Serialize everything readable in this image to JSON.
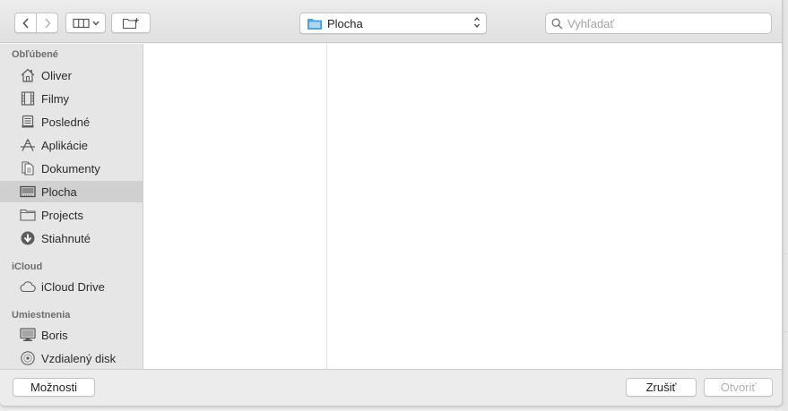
{
  "toolbar": {
    "back_icon": "chevron-left-icon",
    "forward_icon": "chevron-right-icon",
    "view_icon": "column-view-icon",
    "new_folder_icon": "new-folder-icon",
    "location": {
      "label": "Plocha",
      "icon": "desktop-folder-icon"
    },
    "search": {
      "placeholder": "Vyhľadať",
      "value": ""
    }
  },
  "sidebar": {
    "sections": [
      {
        "title": "Obľúbené",
        "items": [
          {
            "label": "Oliver",
            "icon": "home-icon"
          },
          {
            "label": "Filmy",
            "icon": "film-icon"
          },
          {
            "label": "Posledné",
            "icon": "recents-icon"
          },
          {
            "label": "Aplikácie",
            "icon": "applications-icon"
          },
          {
            "label": "Dokumenty",
            "icon": "documents-icon"
          },
          {
            "label": "Plocha",
            "icon": "desktop-icon",
            "selected": true
          },
          {
            "label": "Projects",
            "icon": "folder-icon"
          },
          {
            "label": "Stiahnuté",
            "icon": "download-icon"
          }
        ]
      },
      {
        "title": "iCloud",
        "items": [
          {
            "label": "iCloud Drive",
            "icon": "cloud-icon"
          }
        ]
      },
      {
        "title": "Umiestnenia",
        "items": [
          {
            "label": "Boris",
            "icon": "computer-icon"
          },
          {
            "label": "Vzdialený disk",
            "icon": "disc-icon"
          }
        ]
      }
    ]
  },
  "footer": {
    "options_label": "Možnosti",
    "cancel_label": "Zrušiť",
    "open_label": "Otvoriť"
  },
  "colors": {
    "selected_row": "#d0d0d0",
    "folder_blue": "#4fa7e9",
    "disabled_text": "#b0b0b0"
  }
}
